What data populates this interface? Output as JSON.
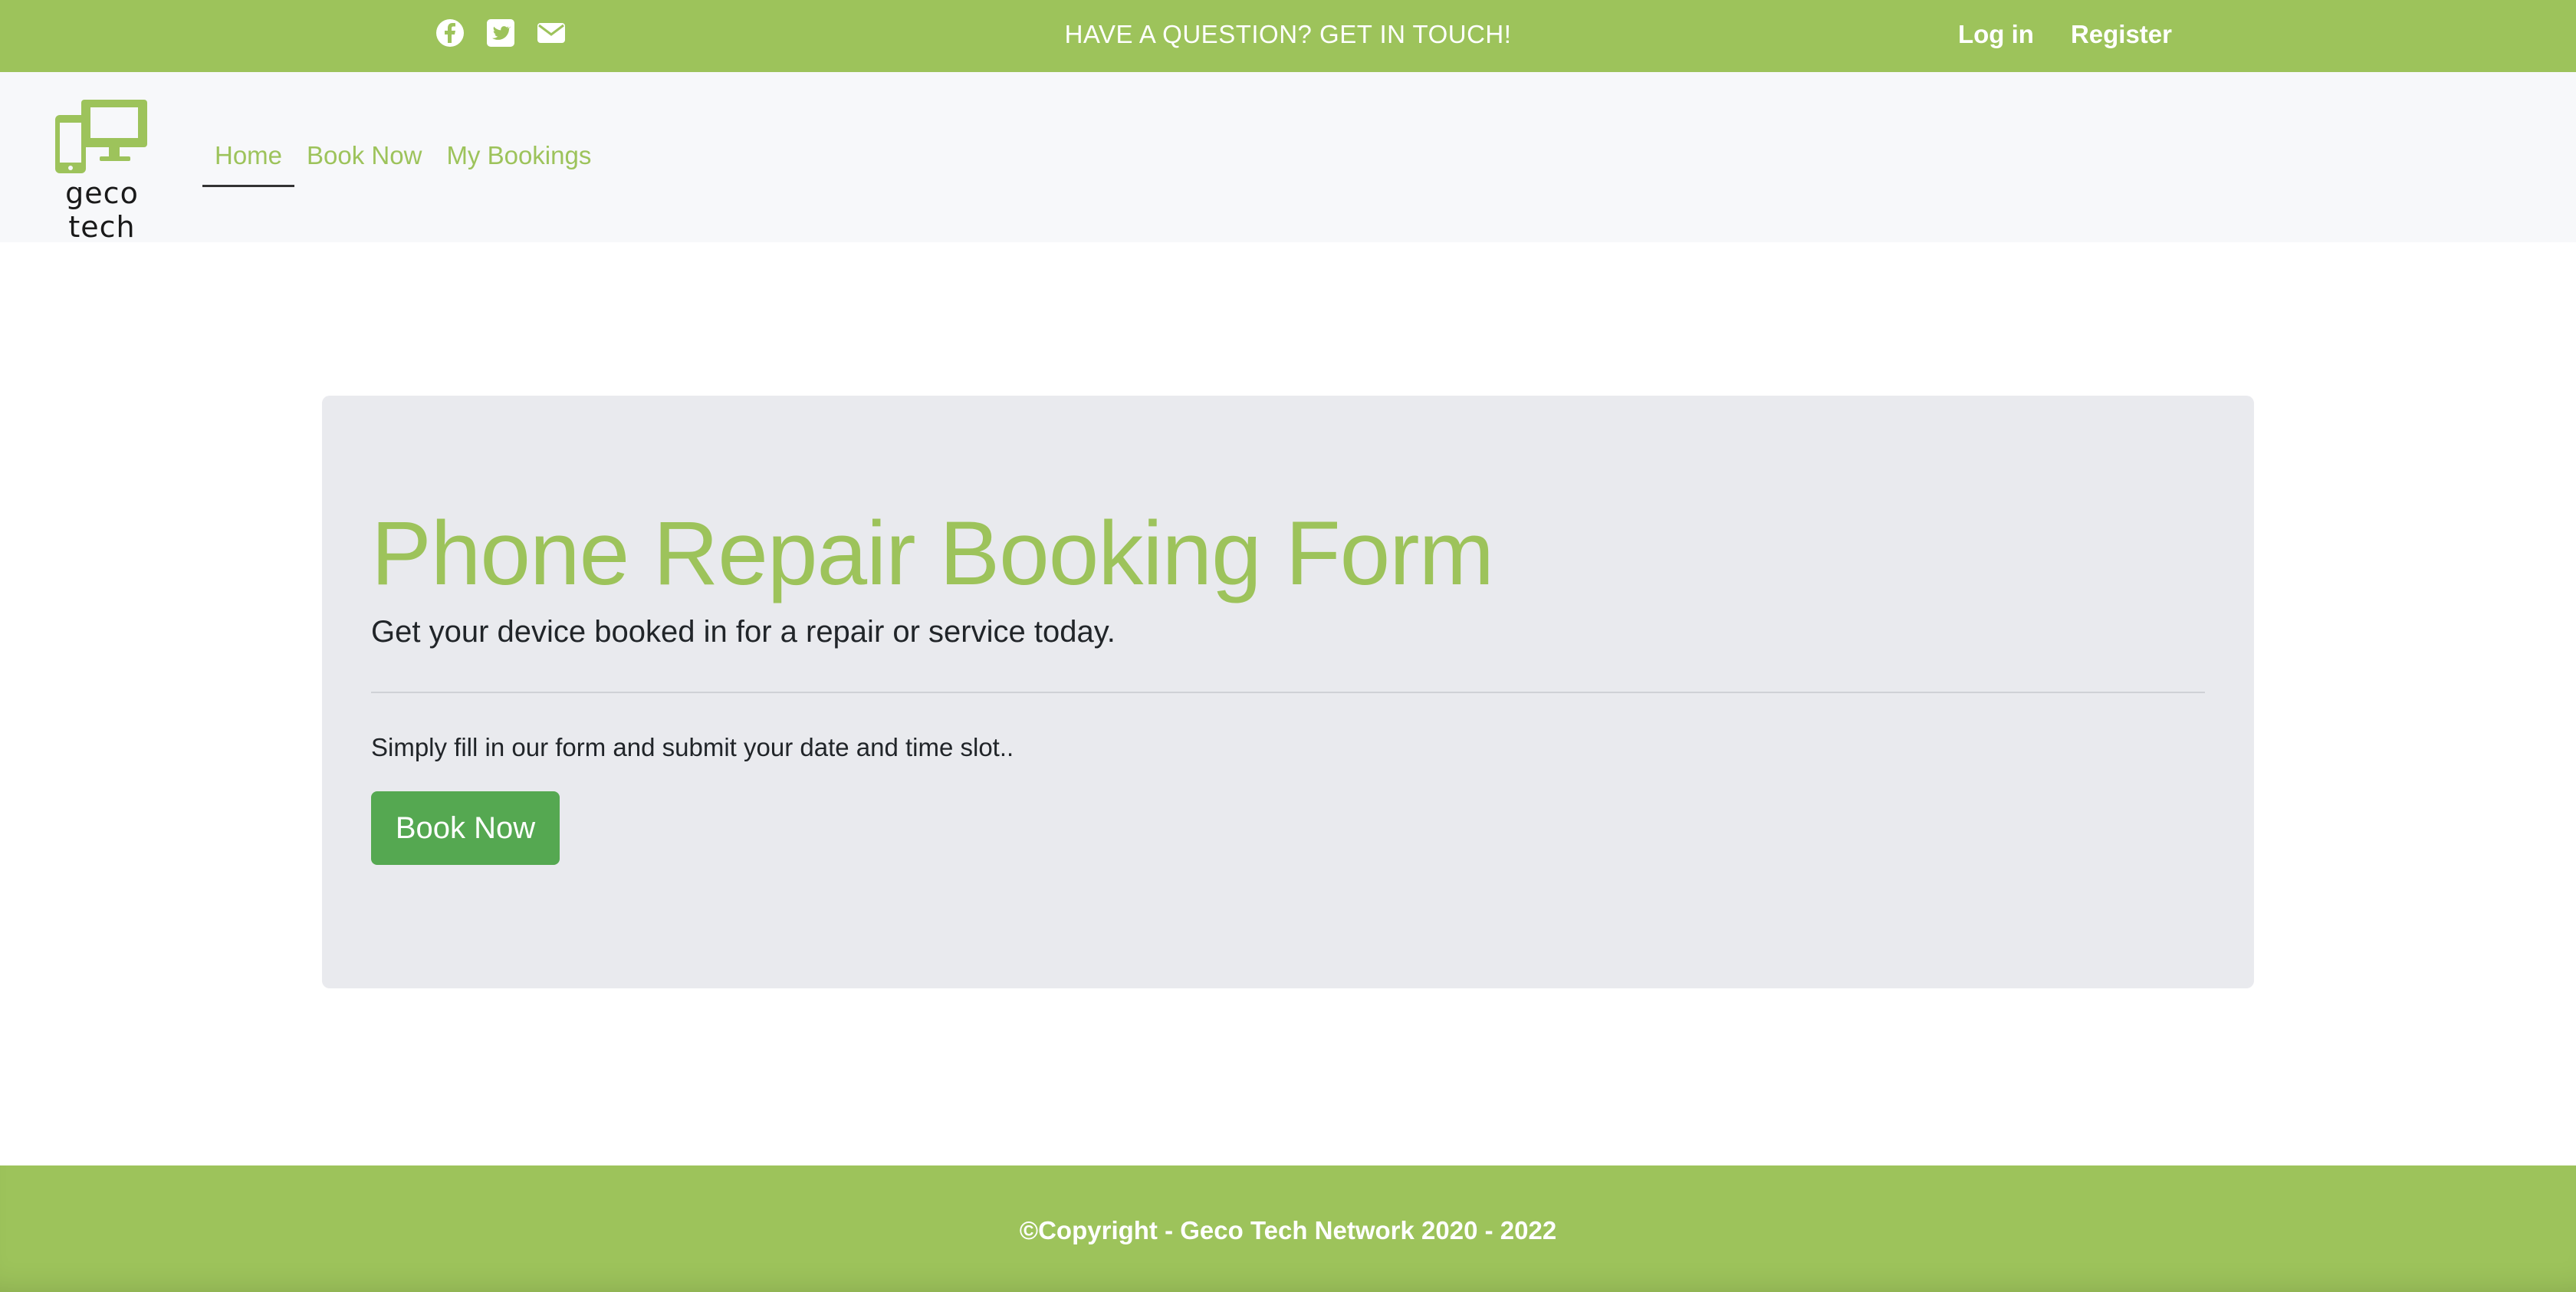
{
  "topbar": {
    "social": [
      {
        "icon": "facebook-icon"
      },
      {
        "icon": "twitter-icon"
      },
      {
        "icon": "email-icon"
      }
    ],
    "question": "HAVE A QUESTION? GET IN TOUCH!",
    "login_label": "Log in",
    "register_label": "Register"
  },
  "navbar": {
    "logo_text": "geco tech",
    "links": [
      "Home",
      "Book Now",
      "My Bookings"
    ],
    "active": "Home"
  },
  "hero": {
    "title": "Phone Repair Booking Form",
    "lead": "Get your device booked in for a repair or service today.",
    "subtext": "Simply fill in our form and submit your date and time slot..",
    "button_label": "Book Now"
  },
  "footer": {
    "copyright": "©Copyright - Geco Tech Network 2020 - 2022"
  },
  "colors": {
    "brand_green": "#9dc35b",
    "button_green": "#55a851",
    "hero_bg": "#e9eaee",
    "nav_bg": "#f7f8fa"
  }
}
